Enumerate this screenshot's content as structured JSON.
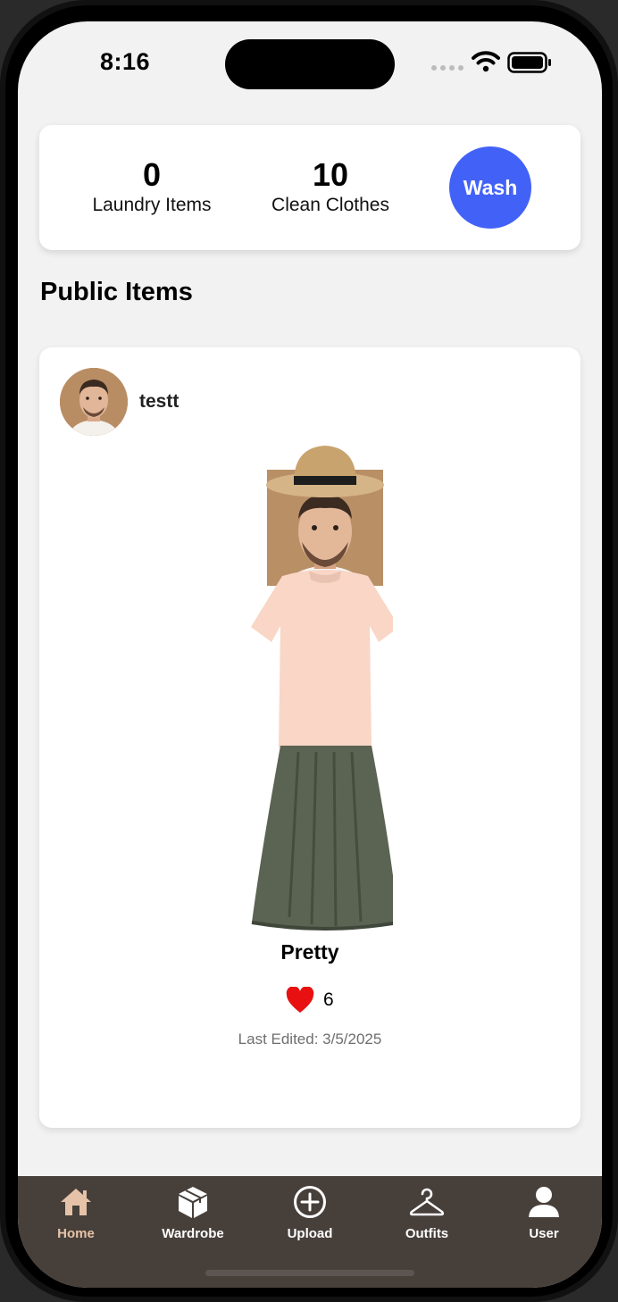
{
  "status_bar": {
    "time": "8:16"
  },
  "stats": {
    "laundry_value": "0",
    "laundry_label": "Laundry Items",
    "clean_value": "10",
    "clean_label": "Clean Clothes",
    "wash_label": "Wash"
  },
  "colors": {
    "accent": "#4262f7",
    "tab_bar": "#473f3a",
    "active_tab": "#e6c3a8",
    "like": "#e81010"
  },
  "section_title": "Public Items",
  "post": {
    "username": "testt",
    "outfit_name": "Pretty",
    "likes": "6",
    "last_edited": "Last Edited: 3/5/2025"
  },
  "tabs": [
    {
      "label": "Home",
      "icon": "home-icon",
      "active": true
    },
    {
      "label": "Wardrobe",
      "icon": "box-icon"
    },
    {
      "label": "Upload",
      "icon": "plus-circle-icon"
    },
    {
      "label": "Outfits",
      "icon": "hanger-icon"
    },
    {
      "label": "User",
      "icon": "user-icon"
    }
  ]
}
